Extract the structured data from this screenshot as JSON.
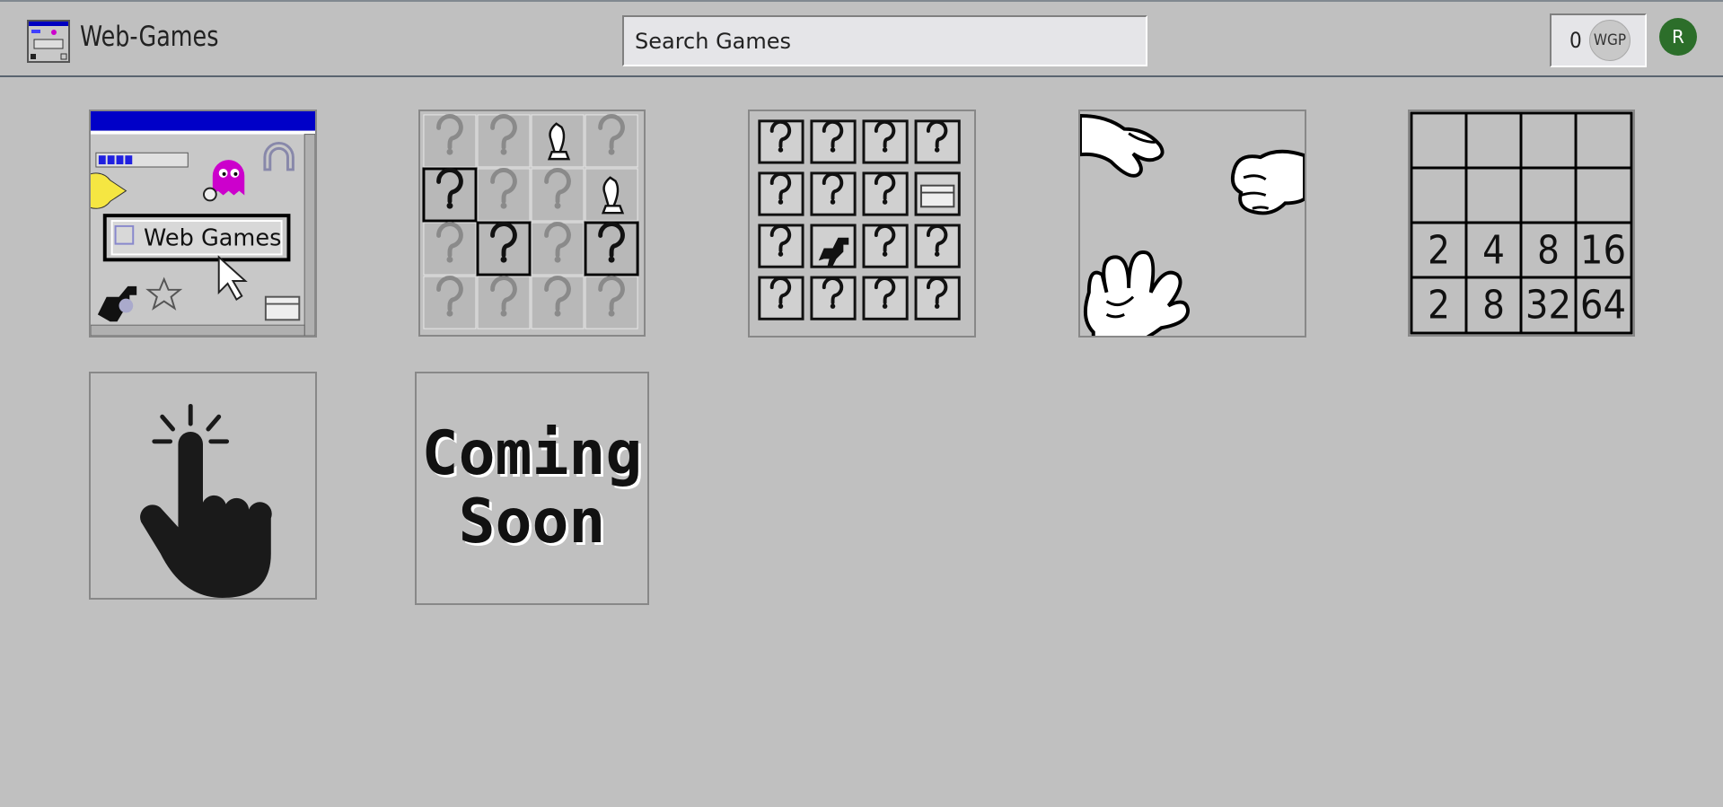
{
  "header": {
    "brand": "Web-Games",
    "search_placeholder": "Search Games",
    "wallet_amount": "0",
    "wallet_currency": "WGP",
    "avatar_initial": "R"
  },
  "games": [
    {
      "name": "web-games-tile",
      "logo_text": "Web Games",
      "icon": "web-games-icon"
    },
    {
      "name": "chess-minesweeper-tile",
      "icon": "question-chess-grid-icon"
    },
    {
      "name": "memory-tile",
      "icon": "question-box-grid-icon"
    },
    {
      "name": "rock-paper-scissors-tile",
      "icon": "hands-icon"
    },
    {
      "name": "2048-tile",
      "icon": "number-grid-icon",
      "numbers": [
        "2",
        "4",
        "8",
        "16",
        "2",
        "8",
        "32",
        "64"
      ]
    },
    {
      "name": "clicker-tile",
      "icon": "tap-finger-icon"
    },
    {
      "name": "coming-soon-tile",
      "line1": "Coming",
      "line2": "Soon"
    }
  ],
  "colors": {
    "background": "#c0c0c0",
    "avatar": "#2c6e2a",
    "titlebar": "#0000c8",
    "ghost": "#cc00cc",
    "pacman": "#f5e642"
  }
}
